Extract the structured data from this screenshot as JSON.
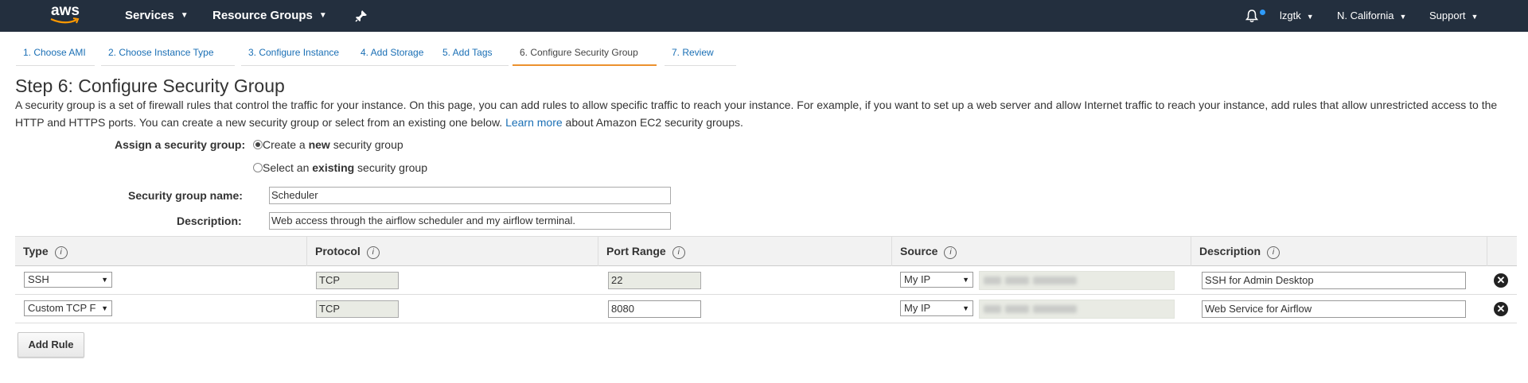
{
  "topnav": {
    "logo_text": "aws",
    "services_label": "Services",
    "resource_groups_label": "Resource Groups",
    "user_label": "lzgtk",
    "region_label": "N. California",
    "support_label": "Support",
    "bg_color": "#232f3e"
  },
  "wizard": {
    "tabs": [
      {
        "label": "1. Choose AMI"
      },
      {
        "label": "2. Choose Instance Type"
      },
      {
        "label": "3. Configure Instance"
      },
      {
        "label": "4. Add Storage"
      },
      {
        "label": "5. Add Tags"
      },
      {
        "label": "6. Configure Security Group",
        "active": true
      },
      {
        "label": "7. Review"
      }
    ],
    "active_color": "#ec912d"
  },
  "page": {
    "title": "Step 6: Configure Security Group",
    "intro_text": "A security group is a set of firewall rules that control the traffic for your instance. On this page, you can add rules to allow specific traffic to reach your instance. For example, if you want to set up a web server and allow Internet traffic to reach your instance, add rules that allow unrestricted access to the HTTP and HTTPS ports. You can create a new security group or select from an existing one below.",
    "learn_more_label": "Learn more",
    "intro_suffix": "about Amazon EC2 security groups."
  },
  "form": {
    "assign_label": "Assign a security group:",
    "option_new_prefix": "Create a ",
    "option_new_bold": "new",
    "option_new_suffix": " security group",
    "option_existing_prefix": "Select an ",
    "option_existing_bold": "existing",
    "option_existing_suffix": " security group",
    "selected_option": "new",
    "name_label": "Security group name:",
    "name_value": "Scheduler",
    "description_label": "Description:",
    "description_value": "Web access through the airflow scheduler and my airflow terminal."
  },
  "rules_table": {
    "headers": {
      "type": "Type",
      "protocol": "Protocol",
      "port_range": "Port Range",
      "source": "Source",
      "description": "Description"
    },
    "rows": [
      {
        "type": "SSH",
        "protocol": "TCP",
        "port_range": "22",
        "source": "My IP",
        "description": "SSH for Admin Desktop",
        "port_editable": false
      },
      {
        "type": "Custom TCP F",
        "protocol": "TCP",
        "port_range": "8080",
        "source": "My IP",
        "description": "Web Service for Airflow",
        "port_editable": true
      }
    ],
    "add_rule_label": "Add Rule"
  }
}
